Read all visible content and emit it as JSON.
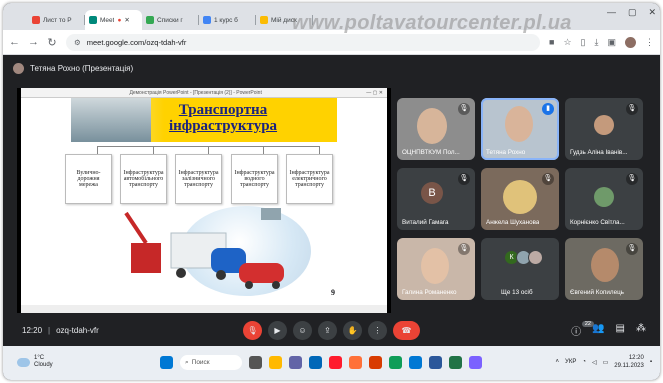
{
  "browser": {
    "tabs": [
      {
        "label": "Лист то Р",
        "color": "#ea4335"
      },
      {
        "label": "Meet",
        "color": "#00897b"
      },
      {
        "label": "Списки г",
        "color": "#34a853"
      },
      {
        "label": "1 курс б",
        "color": "#4285f4"
      },
      {
        "label": "Мій диск",
        "color": "#fbbc04"
      }
    ],
    "address": "meet.google.com/ozq-tdah-vfr"
  },
  "watermark": "www.poltavatourcenter.pl.ua",
  "meet": {
    "presenter_label": "Тетяна Рохно (Презентація)",
    "ppt_title": "Демонстрація PowerPoint - [Презентація (2)] - PowerPoint",
    "slide": {
      "title_line1": "Транспортна",
      "title_line2": "інфраструктура",
      "boxes": [
        "Вулично-дорожня мережа",
        "Інфраструктура автомобільного транспорту",
        "Інфраструктура залізничного транспорту",
        "Інфраструктура водного транспорту",
        "Інфраструктура електричного транспорту"
      ],
      "page": "9"
    },
    "participants": [
      {
        "name": "ОЦНПВТКУМ Пол...",
        "muted": true,
        "bg": "#8d8d8d",
        "type": "video"
      },
      {
        "name": "Тетяна Рохно",
        "muted": false,
        "bg": "#b8c4cf",
        "type": "video",
        "speaking": true
      },
      {
        "name": "Гудзь Аліна Іванів...",
        "muted": true,
        "bg": "#3c4043",
        "type": "small"
      },
      {
        "name": "Виталий Гамага",
        "muted": true,
        "bg": "#3c4043",
        "type": "letter",
        "letter": "В"
      },
      {
        "name": "Анжела Шуханова",
        "muted": true,
        "bg": "#7b6a5c",
        "type": "video"
      },
      {
        "name": "Корнієнко Світла...",
        "muted": true,
        "bg": "#3c4043",
        "type": "small"
      },
      {
        "name": "Галина Романенко",
        "muted": true,
        "bg": "#c9b7a9",
        "type": "video"
      },
      {
        "name": "Ще 13 осіб",
        "muted": false,
        "bg": "#3c4043",
        "type": "more",
        "avatars": [
          "К",
          "",
          ""
        ]
      },
      {
        "name": "Євгений Копилець",
        "muted": true,
        "bg": "#6d6a62",
        "type": "video"
      }
    ],
    "time": "12:20",
    "meeting_code": "ozq-tdah-vfr",
    "people_count": "22"
  },
  "taskbar": {
    "temp": "1°C",
    "weather": "Cloudy",
    "search": "Поиск",
    "lang": "УКР",
    "clock_time": "12:20",
    "clock_date": "29.11.2023"
  }
}
